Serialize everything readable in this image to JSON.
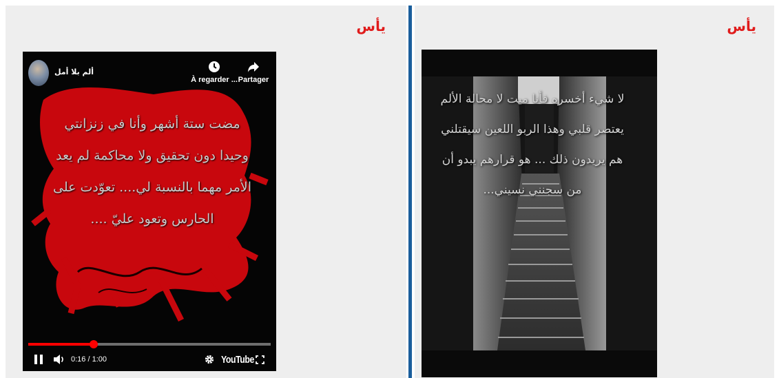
{
  "left_post": {
    "title": "يأس",
    "video": {
      "channel_name": "ألم بلا أمل",
      "watch_later_label": "À regarder ...",
      "share_label": "Partager",
      "poem_lines": [
        "مضت ستة أشهر وأنا في زنزانتي",
        "وحيدا دون تحقيق ولا محاكمة لم يعد",
        "الأمر مهما بالنسبة لي.... تعوّدت على",
        "الحارس وتعود عليّ ...."
      ],
      "time_display": "0:16 / 1:00",
      "brand": "YouTube",
      "progress": 0.27,
      "progress_color": "#ff0000",
      "background_art_color": "#c8070d",
      "icons": [
        "channel-avatar",
        "clock-icon",
        "share-arrow-icon",
        "pause-icon",
        "volume-icon",
        "gear-icon",
        "fullscreen-icon"
      ]
    }
  },
  "right_post": {
    "title": "يأس",
    "image": {
      "poem_lines": [
        "لا شيء أخسره فأنا ميت لا محالة الألم",
        "يعتصر قلبي وهذا الربو اللعين سيقتلني",
        "هم يريدون ذلك ... هو قرارهم يبدو أن",
        "من سجنني نسيني..."
      ]
    }
  },
  "colors": {
    "title_red": "#e01b1b",
    "divider_blue": "#1a5e9c",
    "panel_bg": "#eeeeee"
  }
}
